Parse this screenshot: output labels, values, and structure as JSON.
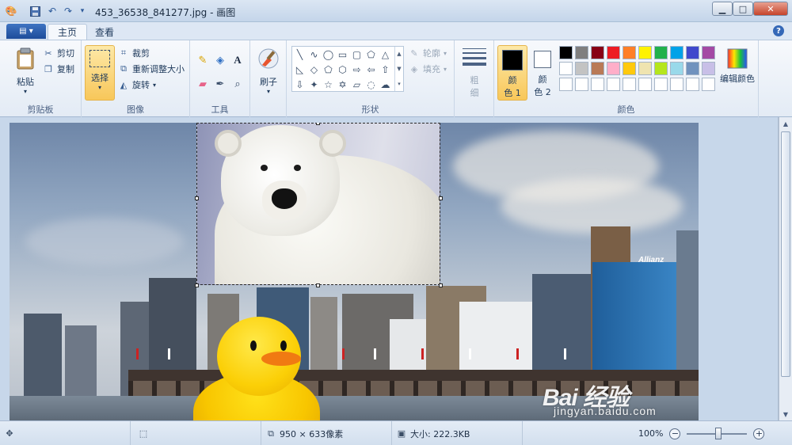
{
  "window": {
    "title": "453_36538_841277.jpg - 画图"
  },
  "tabs": [
    {
      "label": "主页",
      "active": true
    },
    {
      "label": "查看",
      "active": false
    }
  ],
  "clipboard": {
    "paste": "粘贴",
    "cut": "剪切",
    "copy": "复制",
    "label": "剪贴板"
  },
  "image": {
    "select": "选择",
    "crop": "裁剪",
    "resize": "重新调整大小",
    "rotate": "旋转",
    "label": "图像"
  },
  "tools": {
    "label": "工具",
    "text_tool": "A"
  },
  "brushes": {
    "label": "刷子"
  },
  "shapes": {
    "outline": "轮廓",
    "fill": "填充",
    "label": "形状"
  },
  "size": {
    "label_top": "粗",
    "label_bottom": "细"
  },
  "colors": {
    "color1_top": "颜",
    "color1_bottom": "色 1",
    "color2_top": "颜",
    "color2_bottom": "色 2",
    "color1_value": "#000000",
    "color2_value": "#ffffff",
    "edit": "编辑颜色",
    "label": "颜色",
    "palette_row1": [
      "#000000",
      "#7f7f7f",
      "#880015",
      "#ed1c24",
      "#ff7f27",
      "#fff200",
      "#22b14c",
      "#00a2e8",
      "#3f48cc",
      "#a349a4"
    ],
    "palette_row2": [
      "#ffffff",
      "#c3c3c3",
      "#b97a57",
      "#ffaec9",
      "#ffc90e",
      "#efe4b0",
      "#b5e61d",
      "#99d9ea",
      "#7092be",
      "#c8bfe7"
    ]
  },
  "canvas": {
    "sign_text": "Allianz"
  },
  "watermark": {
    "logo": "Bai 经验",
    "url": "jingyan.baidu.com"
  },
  "status": {
    "dimensions": "950 × 633像素",
    "filesize": "大小: 222.3KB",
    "zoom": "100%"
  }
}
